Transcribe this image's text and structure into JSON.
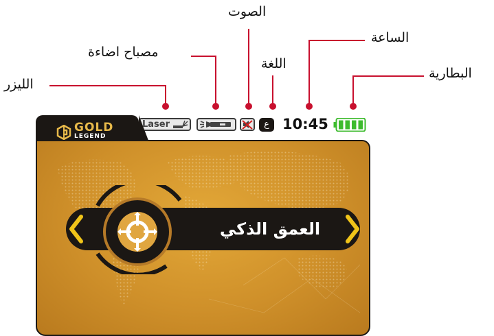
{
  "annotations": {
    "sound": "الصوت",
    "clock": "الساعة",
    "lamp": "مصباح اضاءة",
    "language": "اللغة",
    "battery": "البطارية",
    "laser": "الليزر"
  },
  "brand": {
    "line1": "GOLD",
    "line2": "LEGEND"
  },
  "status_bar": {
    "laser_label": "Laser",
    "language_glyph": "ع",
    "time": "10:45",
    "battery_level": 1.0
  },
  "menu": {
    "current_item": "العمق الذكي",
    "prev_arrow": "‹",
    "next_arrow": "›",
    "icon": "crosshair-target-icon"
  },
  "colors": {
    "callout_line": "#c8102e",
    "screen_gold": "#d89a2e",
    "dark": "#1b1714",
    "arrow_yellow": "#f0c419",
    "battery_green": "#3dbb2e"
  }
}
